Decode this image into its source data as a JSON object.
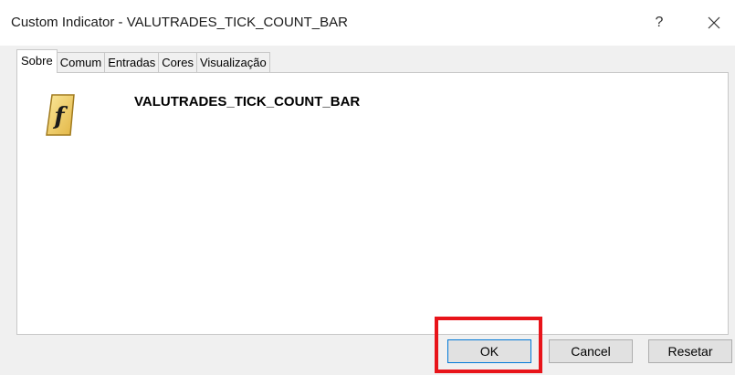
{
  "window": {
    "title": "Custom Indicator - VALUTRADES_TICK_COUNT_BAR",
    "help_label": "?"
  },
  "tabs": [
    {
      "label": "Sobre",
      "active": true
    },
    {
      "label": "Comum",
      "active": false
    },
    {
      "label": "Entradas",
      "active": false
    },
    {
      "label": "Cores",
      "active": false
    },
    {
      "label": "Visualização",
      "active": false
    }
  ],
  "about": {
    "icon": "function-icon",
    "indicator_name": "VALUTRADES_TICK_COUNT_BAR",
    "icon_glyph": "f"
  },
  "buttons": {
    "ok": "OK",
    "cancel": "Cancel",
    "reset": "Resetar"
  },
  "colors": {
    "highlight": "#e8141a",
    "icon_fill": "#f2d36b",
    "icon_border": "#a07a1e"
  }
}
